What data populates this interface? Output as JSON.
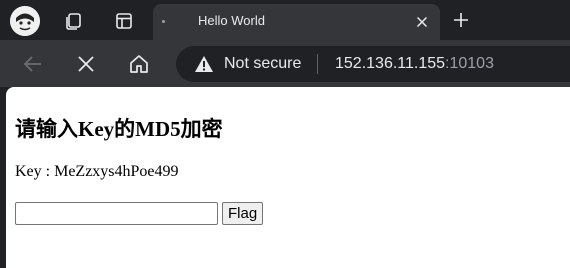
{
  "tab": {
    "title": "Hello World",
    "close_icon": "close-icon",
    "new_tab_icon": "plus-icon"
  },
  "toolbar": {
    "back_icon": "arrow-left-icon",
    "stop_icon": "close-icon",
    "home_icon": "home-icon",
    "security_label": "Not secure",
    "url_host": "152.136.11.155",
    "url_port": ":10103"
  },
  "page": {
    "heading": "请输入Key的MD5加密",
    "key_line": "Key : MeZzxys4hPoe499",
    "input_value": "",
    "submit_label": "Flag"
  },
  "colors": {
    "frame": "#202124",
    "toolbar": "#35363a",
    "text_light": "#e8eaed",
    "text_dim": "#9aa0a6"
  }
}
